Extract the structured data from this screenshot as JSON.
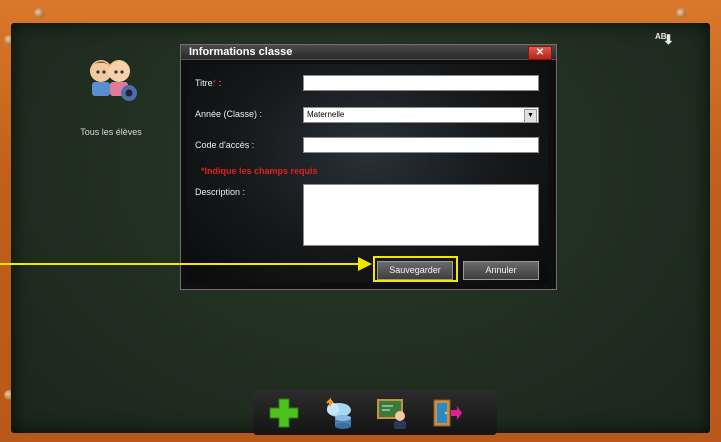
{
  "sort_icon": {
    "letters": "AB",
    "arrow": "⬇"
  },
  "class_list": [
    {
      "label": "Tous les élèves"
    }
  ],
  "dialog": {
    "title": "Informations classe",
    "close": "✕",
    "fields": {
      "titre_label": "Titre",
      "titre_required": "*",
      "titre_suffix": " :",
      "titre_value": "",
      "annee_label": "Année (Classe) :",
      "annee_value": "Maternelle",
      "code_label": "Code d'accès :",
      "code_value": "",
      "required_hint": "*Indique les champs requis",
      "description_label": "Description :",
      "description_value": ""
    },
    "buttons": {
      "save": "Sauvegarder",
      "cancel": "Annuler"
    }
  },
  "toolbar": {
    "items": [
      {
        "icon": "add-plus-icon"
      },
      {
        "icon": "cloud-upload-icon"
      },
      {
        "icon": "teacher-board-icon"
      },
      {
        "icon": "exit-door-icon"
      }
    ]
  },
  "colors": {
    "frame": "#c8661c",
    "board": "#223022",
    "highlight": "#f5e600",
    "required": "#e02020"
  }
}
